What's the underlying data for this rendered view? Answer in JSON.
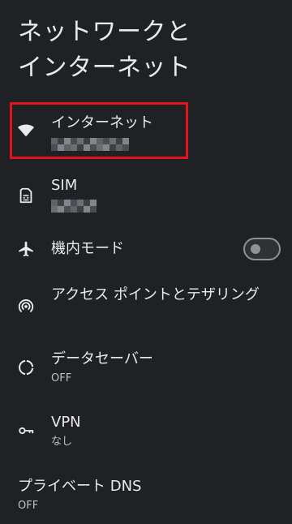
{
  "page": {
    "title_line1": "ネットワークと",
    "title_line2": "インターネット"
  },
  "items": [
    {
      "label": "インターネット",
      "sub": "",
      "icon": "wifi-icon"
    },
    {
      "label": "SIM",
      "sub": "",
      "icon": "sim-card-icon"
    },
    {
      "label": "機内モード",
      "sub": "",
      "icon": "airplane-icon",
      "toggle": false
    },
    {
      "label": "アクセス ポイントとテザリング",
      "sub": "",
      "icon": "hotspot-icon"
    },
    {
      "label": "データセーバー",
      "sub": "OFF",
      "icon": "data-saver-icon"
    },
    {
      "label": "VPN",
      "sub": "なし",
      "icon": "vpn-key-icon"
    },
    {
      "label": "プライベート DNS",
      "sub": "OFF",
      "icon": ""
    }
  ],
  "colors": {
    "background": "#202124",
    "text": "#e8eaed",
    "highlight": "#e3151a"
  }
}
